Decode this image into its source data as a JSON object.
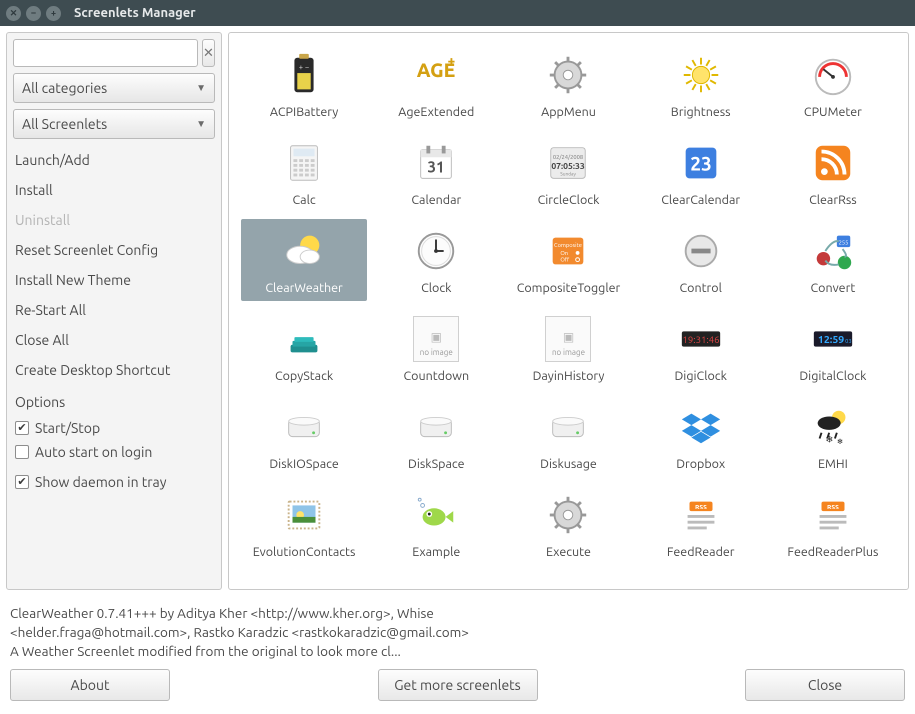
{
  "window": {
    "title": "Screenlets Manager"
  },
  "sidebar": {
    "search_placeholder": "",
    "clear_label": "✕",
    "category_combo": "All categories",
    "screenlet_combo": "All Screenlets",
    "actions": [
      {
        "label": "Launch/Add",
        "enabled": true
      },
      {
        "label": "Install",
        "enabled": true
      },
      {
        "label": "Uninstall",
        "enabled": false
      },
      {
        "label": "Reset Screenlet Config",
        "enabled": true
      },
      {
        "label": "Install New Theme",
        "enabled": true
      },
      {
        "label": "Re-Start All",
        "enabled": true
      },
      {
        "label": "Close All",
        "enabled": true
      },
      {
        "label": "Create Desktop Shortcut",
        "enabled": true
      }
    ],
    "options_heading": "Options",
    "options": [
      {
        "label": "Start/Stop",
        "checked": true
      },
      {
        "label": "Auto start on login",
        "checked": false
      },
      {
        "label": "Show daemon in tray",
        "checked": true
      }
    ]
  },
  "screenlets": [
    {
      "name": "ACPIBattery",
      "icon": "battery",
      "selected": false
    },
    {
      "name": "AgeExtended",
      "icon": "age",
      "selected": false
    },
    {
      "name": "AppMenu",
      "icon": "gear",
      "selected": false
    },
    {
      "name": "Brightness",
      "icon": "sun",
      "selected": false
    },
    {
      "name": "CPUMeter",
      "icon": "gauge",
      "selected": false
    },
    {
      "name": "Calc",
      "icon": "calc",
      "selected": false
    },
    {
      "name": "Calendar",
      "icon": "cal31",
      "selected": false
    },
    {
      "name": "CircleClock",
      "icon": "circleclock",
      "selected": false
    },
    {
      "name": "ClearCalendar",
      "icon": "cal23",
      "selected": false
    },
    {
      "name": "ClearRss",
      "icon": "rss",
      "selected": false
    },
    {
      "name": "ClearWeather",
      "icon": "weather",
      "selected": true
    },
    {
      "name": "Clock",
      "icon": "analog",
      "selected": false
    },
    {
      "name": "CompositeToggler",
      "icon": "composite",
      "selected": false
    },
    {
      "name": "Control",
      "icon": "nodo",
      "selected": false
    },
    {
      "name": "Convert",
      "icon": "convert",
      "selected": false
    },
    {
      "name": "CopyStack",
      "icon": "copystack",
      "selected": false
    },
    {
      "name": "Countdown",
      "icon": "noimage",
      "selected": false
    },
    {
      "name": "DayinHistory",
      "icon": "noimage",
      "selected": false
    },
    {
      "name": "DigiClock",
      "icon": "digiclock",
      "selected": false
    },
    {
      "name": "DigitalClock",
      "icon": "digitalclock",
      "selected": false
    },
    {
      "name": "DiskIOSpace",
      "icon": "drive",
      "selected": false
    },
    {
      "name": "DiskSpace",
      "icon": "drive",
      "selected": false
    },
    {
      "name": "Diskusage",
      "icon": "drive",
      "selected": false
    },
    {
      "name": "Dropbox",
      "icon": "dropbox",
      "selected": false
    },
    {
      "name": "EMHI",
      "icon": "emhi",
      "selected": false
    },
    {
      "name": "EvolutionContacts",
      "icon": "stamp",
      "selected": false
    },
    {
      "name": "Example",
      "icon": "fish",
      "selected": false
    },
    {
      "name": "Execute",
      "icon": "gear",
      "selected": false
    },
    {
      "name": "FeedReader",
      "icon": "feedreader",
      "selected": false
    },
    {
      "name": "FeedReaderPlus",
      "icon": "feedreader",
      "selected": false
    }
  ],
  "description": {
    "line1": "ClearWeather 0.7.41+++ by Aditya Kher <http://www.kher.org>, Whise",
    "line2": "<helder.fraga@hotmail.com>, Rastko Karadzic <rastkokaradzic@gmail.com>",
    "line3": "A Weather Screenlet modified from the original to look more cl..."
  },
  "buttons": {
    "about": "About",
    "get_more": "Get more screenlets",
    "close": "Close"
  }
}
